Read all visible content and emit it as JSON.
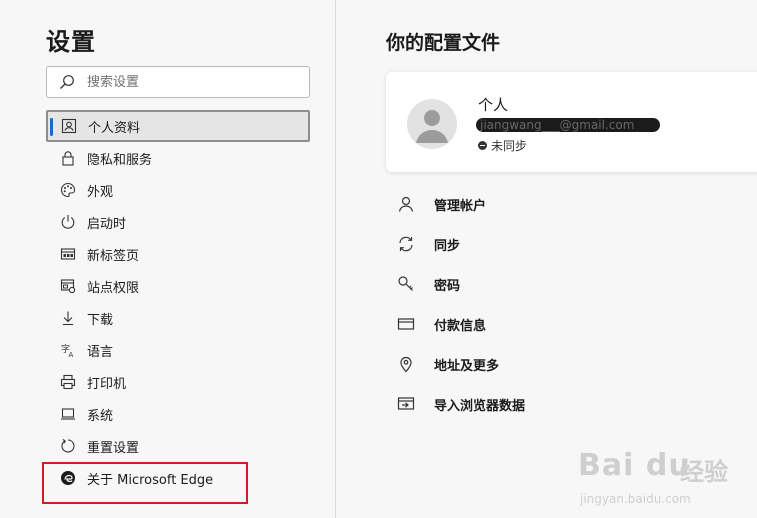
{
  "sidebar": {
    "title": "设置",
    "search_placeholder": "搜索设置",
    "items": [
      {
        "label": "个人资料",
        "icon": "profile-icon"
      },
      {
        "label": "隐私和服务",
        "icon": "lock-icon"
      },
      {
        "label": "外观",
        "icon": "palette-icon"
      },
      {
        "label": "启动时",
        "icon": "power-icon"
      },
      {
        "label": "新标签页",
        "icon": "new-tab-icon"
      },
      {
        "label": "站点权限",
        "icon": "site-permissions-icon"
      },
      {
        "label": "下载",
        "icon": "download-icon"
      },
      {
        "label": "语言",
        "icon": "language-icon"
      },
      {
        "label": "打印机",
        "icon": "printer-icon"
      },
      {
        "label": "系统",
        "icon": "system-icon"
      },
      {
        "label": "重置设置",
        "icon": "reset-icon"
      },
      {
        "label": "关于 Microsoft Edge",
        "icon": "edge-icon"
      }
    ]
  },
  "main": {
    "title": "你的配置文件",
    "profile": {
      "name": "个人",
      "email": "jiangwang___@gmail.com",
      "sync_status": "未同步"
    },
    "menu": [
      {
        "label": "管理帐户",
        "icon": "person-icon"
      },
      {
        "label": "同步",
        "icon": "sync-icon"
      },
      {
        "label": "密码",
        "icon": "key-icon"
      },
      {
        "label": "付款信息",
        "icon": "card-icon"
      },
      {
        "label": "地址及更多",
        "icon": "location-icon"
      },
      {
        "label": "导入浏览器数据",
        "icon": "import-icon"
      }
    ]
  },
  "watermark": {
    "brand": "Bai du",
    "cn": "经验",
    "url": "jingyan.baidu.com"
  },
  "colors": {
    "accent": "#2266cc",
    "highlight_box": "#cc1f1f",
    "active_bg": "#e5e5e5"
  }
}
